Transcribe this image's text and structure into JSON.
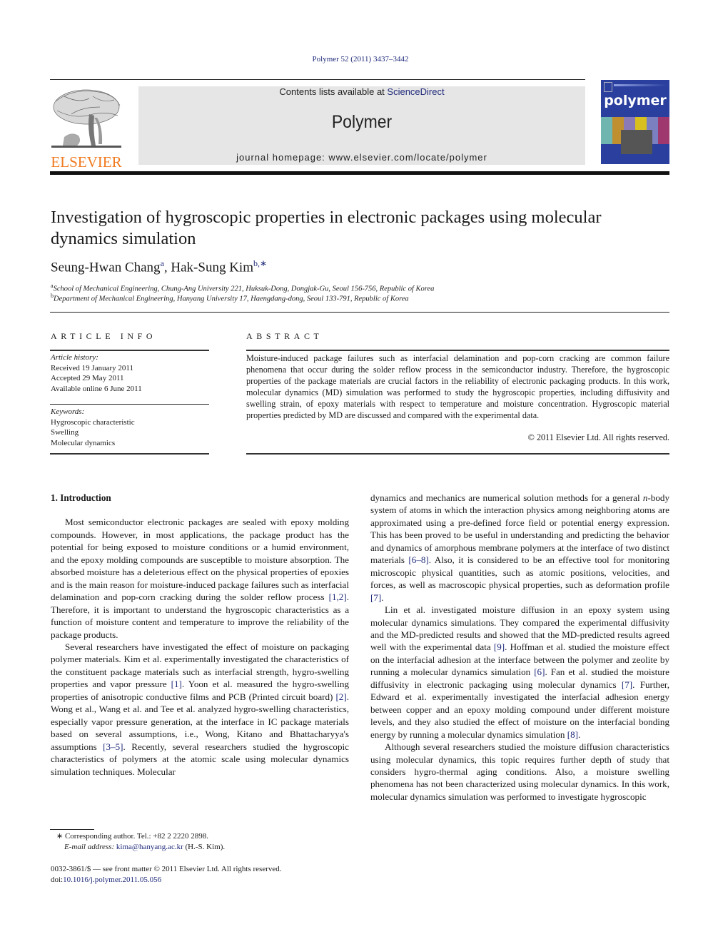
{
  "header": {
    "citation": "Polymer 52 (2011) 3437–3442",
    "contents_prefix": "Contents lists available at ",
    "contents_link": "ScienceDirect",
    "journal_name": "Polymer",
    "homepage": "journal homepage: www.elsevier.com/locate/polymer",
    "publisher_logo_text": "ELSEVIER",
    "cover_title": "polymer"
  },
  "colors": {
    "link": "#1f2a7a",
    "elsevier_orange": "#f07a20",
    "banner_gray": "#e6e6e6",
    "cover_blue": "#2a3f9e"
  },
  "article": {
    "title": "Investigation of hygroscopic properties in electronic packages using molecular dynamics simulation",
    "authors": [
      {
        "name": "Seung-Hwan Chang",
        "sup": "a"
      },
      {
        "name": "Hak-Sung Kim",
        "sup": "b,∗"
      }
    ],
    "author_separator": ", ",
    "affiliations": [
      {
        "sup": "a",
        "text": "School of Mechanical Engineering, Chung-Ang University 221, Huksuk-Dong, Dongjak-Gu, Seoul 156-756, Republic of Korea"
      },
      {
        "sup": "b",
        "text": "Department of Mechanical Engineering, Hanyang University 17, Haengdang-dong, Seoul 133-791, Republic of Korea"
      }
    ]
  },
  "article_info": {
    "heading": "ARTICLE INFO",
    "history_label": "Article history:",
    "history": [
      "Received 19 January 2011",
      "Accepted 29 May 2011",
      "Available online 6 June 2011"
    ],
    "keywords_label": "Keywords:",
    "keywords": [
      "Hygroscopic characteristic",
      "Swelling",
      "Molecular dynamics"
    ]
  },
  "abstract": {
    "heading": "ABSTRACT",
    "text": "Moisture-induced package failures such as interfacial delamination and pop-corn cracking are common failure phenomena that occur during the solder reflow process in the semiconductor industry. Therefore, the hygroscopic properties of the package materials are crucial factors in the reliability of electronic packaging products. In this work, molecular dynamics (MD) simulation was performed to study the hygroscopic properties, including diffusivity and swelling strain, of epoxy materials with respect to temperature and moisture concentration. Hygroscopic material properties predicted by MD are discussed and compared with the experimental data.",
    "copyright": "© 2011 Elsevier Ltd. All rights reserved."
  },
  "body": {
    "section1_heading": "1.  Introduction",
    "p1": [
      {
        "t": "Most semiconductor electronic packages are sealed with epoxy molding compounds. However, in most applications, the package product has the potential for being exposed to moisture conditions or a humid environment, and the epoxy molding compounds are susceptible to moisture absorption. The absorbed moisture has a deleterious effect on the physical properties of epoxies and is the main reason for moisture-induced package failures such as inter­facial delamination and pop-corn cracking during the solder reflow process "
      },
      {
        "ref": "[1,2]"
      },
      {
        "t": ". Therefore, it is important to understand the hygro­scopic characteristics as a function of moisture content and temperature to improve the reliability of the package products."
      }
    ],
    "p2": [
      {
        "t": "Several researchers have investigated the effect of moisture on packaging polymer materials. Kim et al. experimentally investigated the characteristics of the constituent package materials such as interfacial strength, hygro-swelling properties and vapor pressure "
      },
      {
        "ref": "[1]"
      },
      {
        "t": ". Yoon et al. measured the hygro-swelling properties of anisotropic conductive films and PCB (Printed circuit board) "
      },
      {
        "ref": "[2]"
      },
      {
        "t": ". Wong et al., Wang et al. and Tee et al. analyzed hygro-swelling characteristics, especially vapor pressure generation, at the interface in IC package materials based on several assumptions, i.e., Wong, Kitano and Bhattacharyya's assumptions "
      },
      {
        "ref": "[3–5]"
      },
      {
        "t": ". Recently, several researchers studied the hygroscopic characteristics of polymers at the atomic scale using molecular dynamics simulation techniques. Molecular"
      }
    ],
    "p3": [
      {
        "t": "dynamics and mechanics are numerical solution methods for a general "
      },
      {
        "it": "n"
      },
      {
        "t": "-body system of atoms in which the interaction physics among neighboring atoms are approximated using a pre-defined force field or potential energy expression. This has been proved to be useful in understanding and predicting the behavior and dynamics of amorphous membrane polymers at the interface of two distinct materials "
      },
      {
        "ref": "[6–8]"
      },
      {
        "t": ". Also, it is considered to be an effective tool for monitoring microscopic physical quantities, such as atomic positions, velocities, and forces, as well as macroscopic physical properties, such as deformation profile "
      },
      {
        "ref": "[7]"
      },
      {
        "t": "."
      }
    ],
    "p4": [
      {
        "t": "Lin et al. investigated moisture diffusion in an epoxy system using molecular dynamics simulations. They compared the exper­imental diffusivity and the MD-predicted results and showed that the MD-predicted results agreed well with the experimental data "
      },
      {
        "ref": "[9]"
      },
      {
        "t": ". Hoffman et al. studied the moisture effect on the interfacial adhesion at the interface between the polymer and zeolite by running a molecular dynamics simulation "
      },
      {
        "ref": "[6]"
      },
      {
        "t": ". Fan et al. studied the moisture diffusivity in electronic packaging using molecular dynamics "
      },
      {
        "ref": "[7]"
      },
      {
        "t": ". Further, Edward et al. experimentally investigated the interfacial adhesion energy between copper and an epoxy molding compound under different moisture levels, and they also studied the effect of moisture on the interfacial bonding energy by running a molecular dynamics simulation "
      },
      {
        "ref": "[8]"
      },
      {
        "t": "."
      }
    ],
    "p5": [
      {
        "t": "Although several researchers studied the moisture diffusion characteristics using molecular dynamics, this topic requires further depth of study that considers hygro-thermal aging condi­tions. Also, a moisture swelling phenomena has not been charac­terized using molecular dynamics. In this work, molecular dynamics simulation was performed to investigate hygroscopic"
      }
    ]
  },
  "footnotes": {
    "corresponding": "∗  Corresponding author. Tel.: +82 2 2220 2898.",
    "email_label": "E-mail address: ",
    "email": "kima@hanyang.ac.kr",
    "email_suffix": " (H.-S. Kim).",
    "front_matter": "0032-3861/$ — see front matter © 2011 Elsevier Ltd. All rights reserved.",
    "doi_label": "doi:",
    "doi": "10.1016/j.polymer.2011.05.056"
  }
}
